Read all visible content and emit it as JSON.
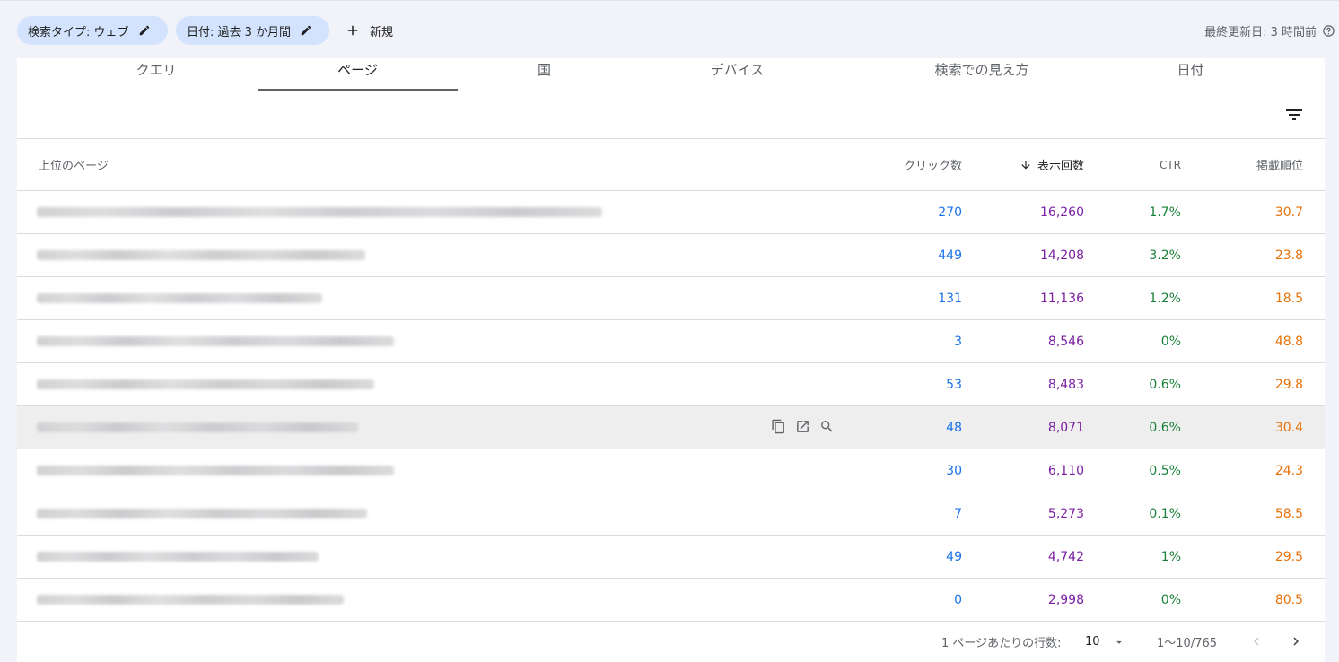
{
  "filters": {
    "search_type_chip": "検索タイプ: ウェブ",
    "date_chip": "日付: 過去 3 か月間",
    "new_label": "新規",
    "last_updated": "最終更新日: 3 時間前"
  },
  "tabs": [
    {
      "label": "クエリ",
      "active": false
    },
    {
      "label": "ページ",
      "active": true
    },
    {
      "label": "国",
      "active": false
    },
    {
      "label": "デバイス",
      "active": false
    },
    {
      "label": "検索での見え方",
      "active": false
    },
    {
      "label": "日付",
      "active": false
    }
  ],
  "table": {
    "headers": {
      "page": "上位のページ",
      "clicks": "クリック数",
      "impressions": "表示回数",
      "ctr": "CTR",
      "position": "掲載順位"
    },
    "rows": [
      {
        "clicks": "270",
        "impressions": "16,260",
        "ctr": "1.7%",
        "position": "30.7"
      },
      {
        "clicks": "449",
        "impressions": "14,208",
        "ctr": "3.2%",
        "position": "23.8"
      },
      {
        "clicks": "131",
        "impressions": "11,136",
        "ctr": "1.2%",
        "position": "18.5"
      },
      {
        "clicks": "3",
        "impressions": "8,546",
        "ctr": "0%",
        "position": "48.8"
      },
      {
        "clicks": "53",
        "impressions": "8,483",
        "ctr": "0.6%",
        "position": "29.8"
      },
      {
        "clicks": "48",
        "impressions": "8,071",
        "ctr": "0.6%",
        "position": "30.4"
      },
      {
        "clicks": "30",
        "impressions": "6,110",
        "ctr": "0.5%",
        "position": "24.3"
      },
      {
        "clicks": "7",
        "impressions": "5,273",
        "ctr": "0.1%",
        "position": "58.5"
      },
      {
        "clicks": "49",
        "impressions": "4,742",
        "ctr": "1%",
        "position": "29.5"
      },
      {
        "clicks": "0",
        "impressions": "2,998",
        "ctr": "0%",
        "position": "80.5"
      }
    ]
  },
  "pagination": {
    "rows_per_page_label": "1 ページあたりの行数:",
    "rows_per_page": "10",
    "range": "1～10/765"
  },
  "colors": {
    "clicks": "#1a73e8",
    "impressions": "#7b1fa2",
    "ctr": "#188038",
    "position": "#e8710a",
    "chip_bg": "#d3e3fd"
  },
  "icons": {
    "chip_edit": "pencil-icon",
    "new": "plus-icon",
    "help": "help-circle-icon",
    "filter": "filter-list-icon",
    "sort": "arrow-down-icon",
    "row_copy": "copy-icon",
    "row_open": "open-in-new-icon",
    "row_inspect": "magnifier-icon",
    "select": "caret-down-icon",
    "prev": "chevron-left-icon",
    "next": "chevron-right-icon"
  }
}
